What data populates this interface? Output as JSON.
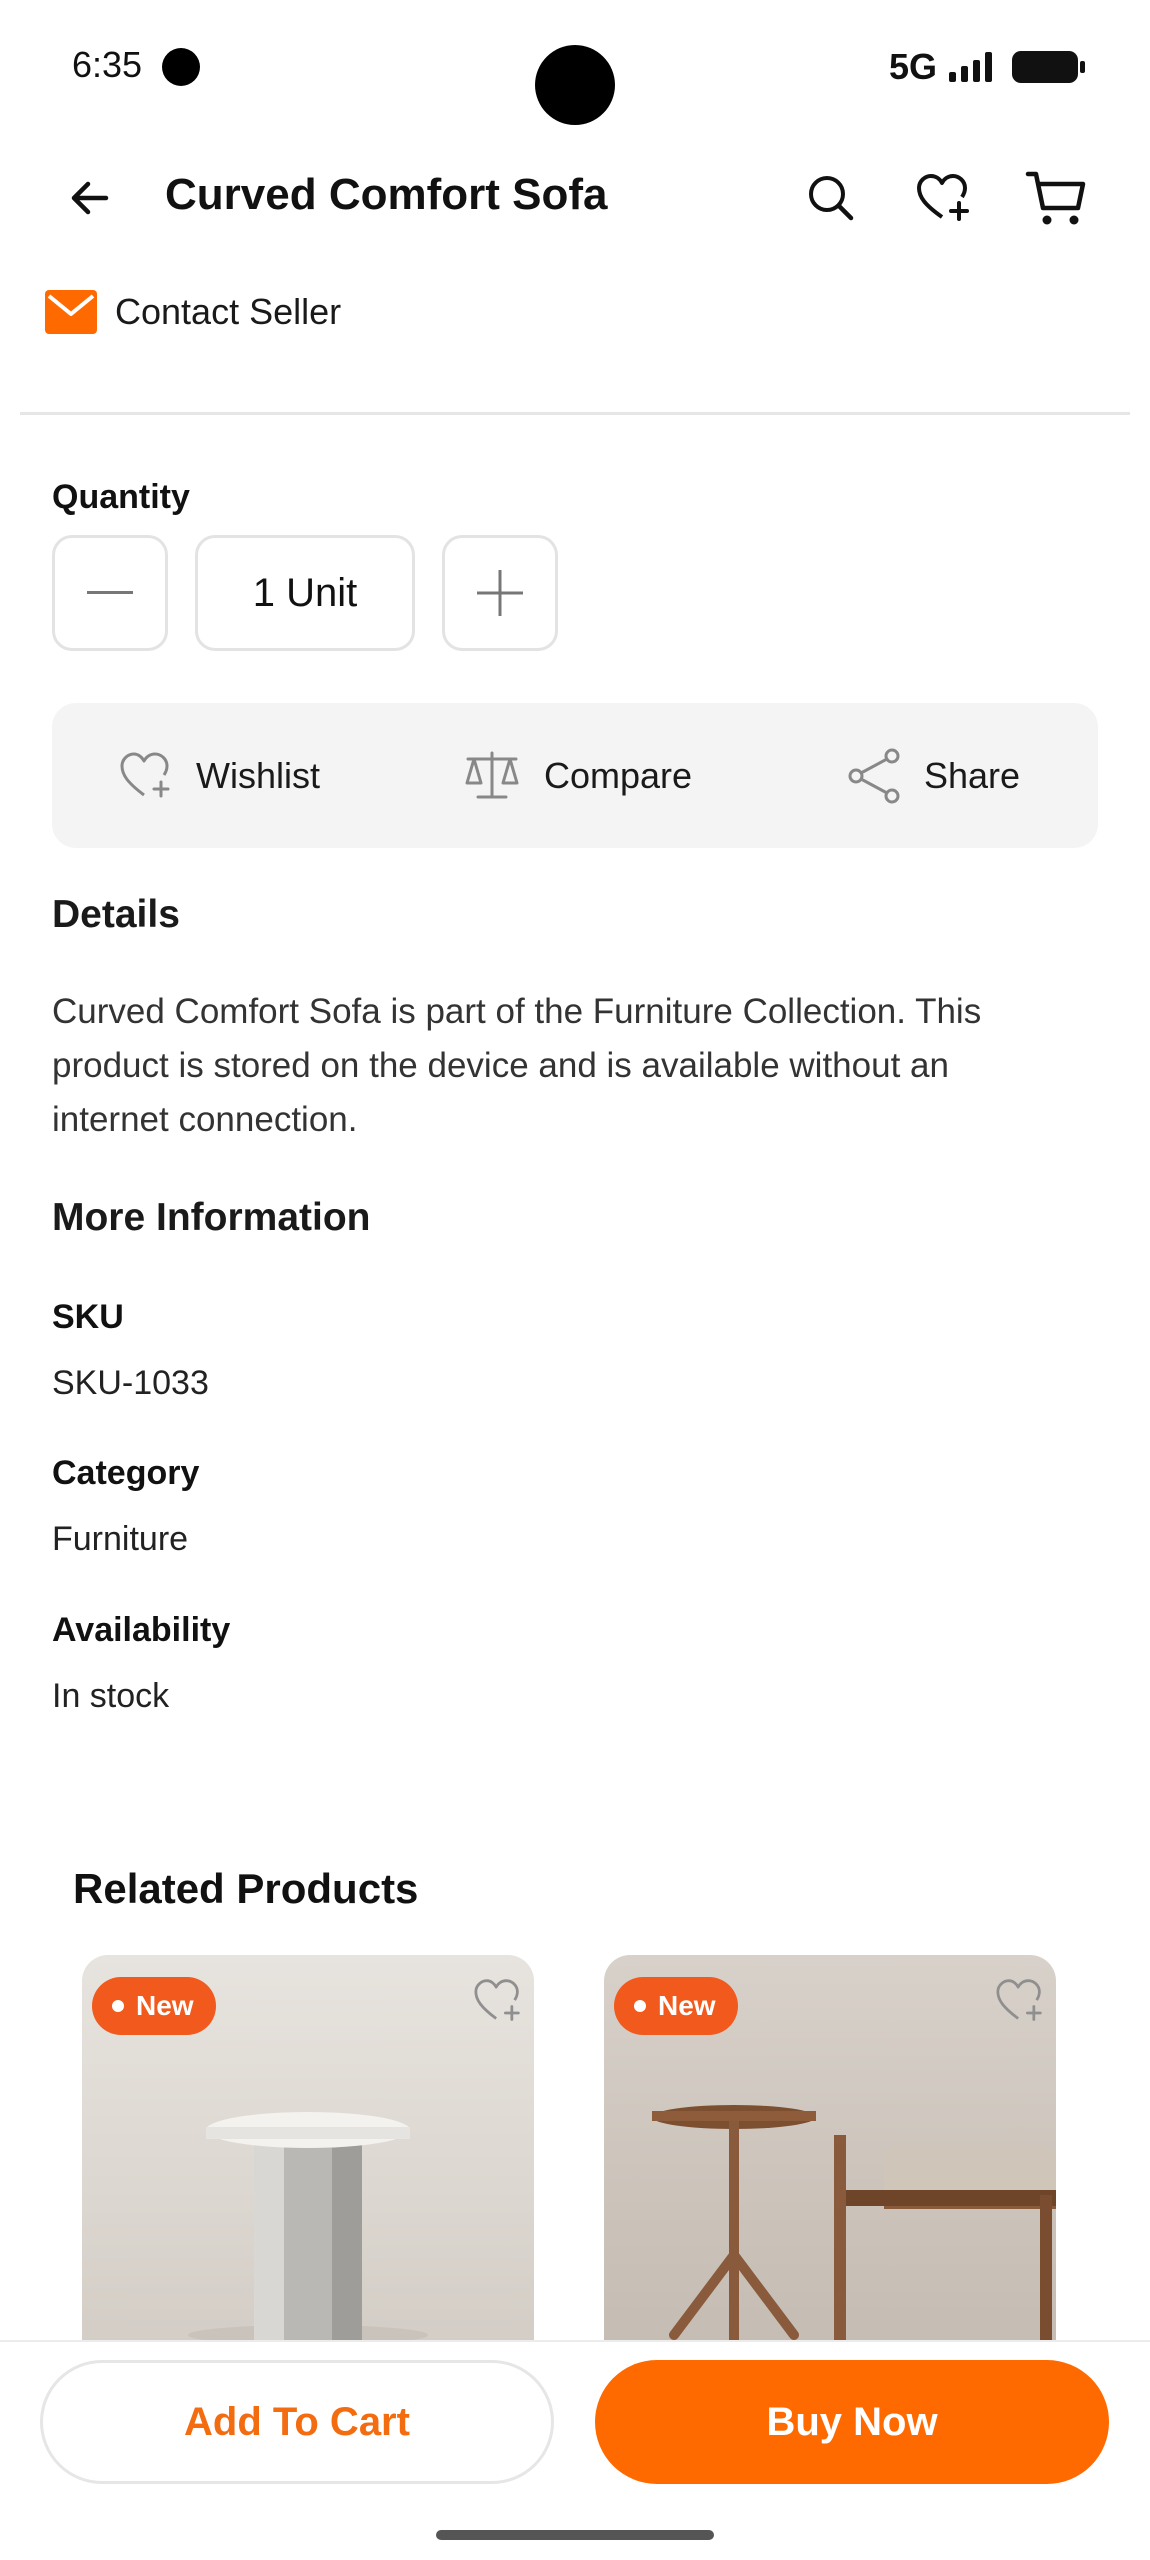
{
  "status_bar": {
    "time": "6:35",
    "network": "5G"
  },
  "header": {
    "title": "Curved Comfort Sofa"
  },
  "contact": {
    "label": "Contact Seller"
  },
  "quantity": {
    "label": "Quantity",
    "value": "1 Unit"
  },
  "actions": {
    "wishlist": "Wishlist",
    "compare": "Compare",
    "share": "Share"
  },
  "details": {
    "title": "Details",
    "line1": "Curved Comfort Sofa is part of the Furniture Collection. This",
    "line2": "product is stored on the device and is available without an",
    "line3": "internet connection."
  },
  "more_info": {
    "title": "More Information",
    "sku_label": "SKU",
    "sku_value": "SKU-1033",
    "category_label": "Category",
    "category_value": "Furniture",
    "availability_label": "Availability",
    "availability_value": "In stock"
  },
  "related": {
    "title": "Related Products",
    "items": [
      {
        "badge": "New"
      },
      {
        "badge": "New"
      }
    ]
  },
  "bottom": {
    "add_to_cart": "Add To Cart",
    "buy_now": "Buy Now"
  },
  "colors": {
    "accent": "#ff6a00",
    "badge": "#f15a1c",
    "mail": "#ff6a00"
  }
}
